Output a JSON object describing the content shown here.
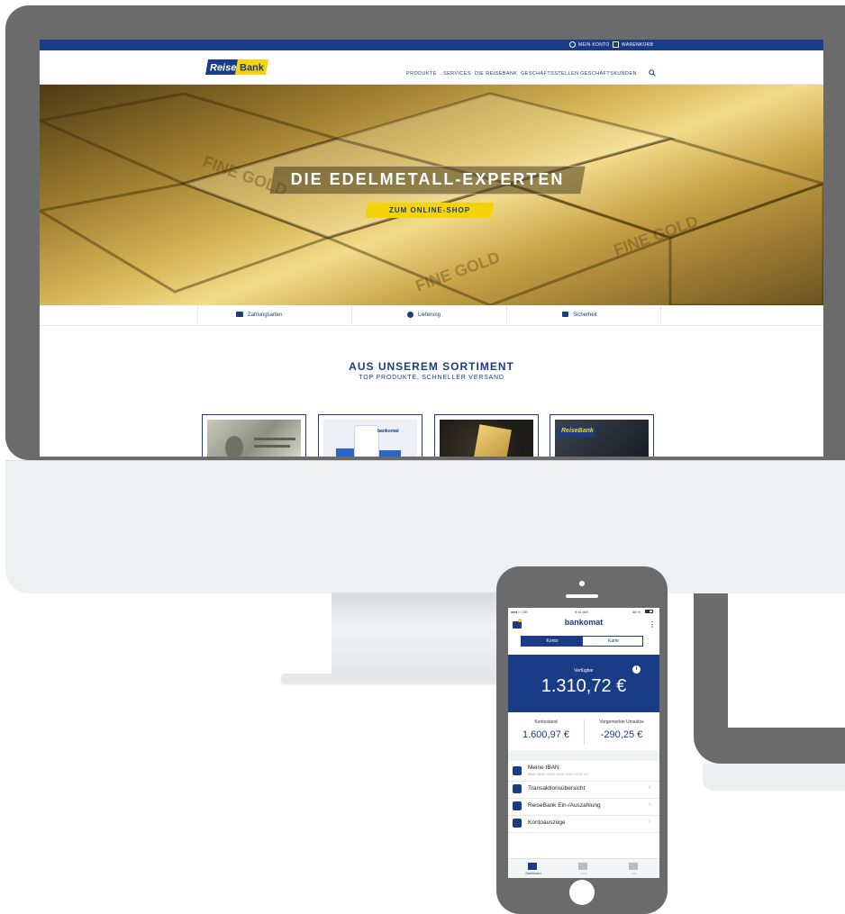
{
  "website": {
    "topbar": {
      "account": "MEIN KONTO",
      "cart": "WARENKORB"
    },
    "logo": {
      "reise": "Reise",
      "bank": "Bank"
    },
    "nav": [
      "PRODUKTE",
      "SERVICES",
      "DIE REISEBANK",
      "GESCHÄFTSSTELLEN",
      "GESCHÄFTSKUNDEN"
    ],
    "hero": {
      "title": "DIE EDELMETALL-EXPERTEN",
      "button": "ZUM ONLINE-SHOP"
    },
    "info_items": [
      "Zahlungsarten",
      "Lieferung",
      "Sicherheit"
    ],
    "sortiment": {
      "title": "AUS UNSEREM SORTIMENT",
      "subtitle": "TOP PRODUKTE, SCHNELLER VERSAND"
    },
    "cards": [
      {
        "icon": "dollar-bills-image"
      },
      {
        "icon": "bankomat-app-image",
        "text": "bankomat"
      },
      {
        "icon": "gold-bar-image"
      },
      {
        "icon": "reisebank-card-image",
        "text": "ReiseBank"
      }
    ]
  },
  "phone_app": {
    "status": {
      "carrier": "●●●○○ DE",
      "time": "9:41 AM",
      "battery": "58 %"
    },
    "app_name": "bankomat",
    "tabs": {
      "active": "Konto",
      "inactive": "Karte"
    },
    "balance": {
      "label": "Verfügbar",
      "value": "1.310,72 €"
    },
    "kontostand": {
      "label": "Kontostand",
      "value": "1.600,97 €"
    },
    "vorgemerkt": {
      "label": "Vorgemerkte Umsätze",
      "value": "-290,25 €"
    },
    "list": [
      {
        "label": "Meine IBAN",
        "sub": "IBAN: DEXX XXXX XXXX XXXX XXXX XX"
      },
      {
        "label": "Transaktionsübersicht"
      },
      {
        "label": "ReiseBank Ein-/Auszahlung"
      },
      {
        "label": "Kontoauszüge"
      }
    ],
    "bottom_nav": [
      "Dashboard",
      "Geld",
      "Info"
    ]
  },
  "colors": {
    "brand_blue": "#1a3b86",
    "brand_yellow": "#f5d30a",
    "device_gray": "#6b6b6b"
  }
}
